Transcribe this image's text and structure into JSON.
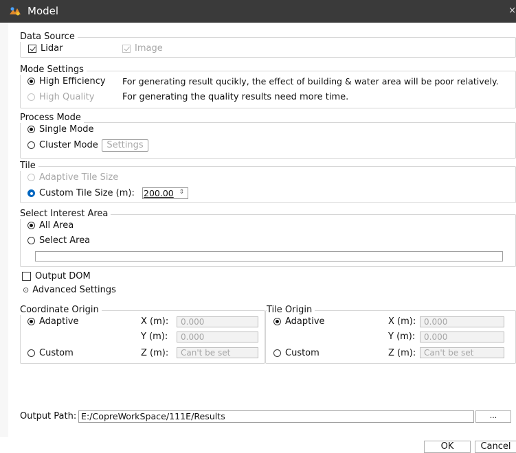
{
  "window": {
    "title": "Model",
    "close_glyph": "×",
    "icon": "app-icon"
  },
  "data_source": {
    "title": "Data Source",
    "lidar": "Lidar",
    "image": "Image"
  },
  "mode_settings": {
    "title": "Mode Settings",
    "high_efficiency": "High Efficiency",
    "high_efficiency_desc": "For generating result qucikly, the effect of building & water area will be poor relatively.",
    "high_quality": "High Quality",
    "high_quality_desc": "For generating the quality results need more time."
  },
  "process_mode": {
    "title": "Process Mode",
    "single": "Single Mode",
    "cluster": "Cluster Mode",
    "settings": "Settings"
  },
  "tile": {
    "title": "Tile",
    "adaptive": "Adaptive Tile Size",
    "custom": "Custom Tile Size (m):",
    "value": "200.00",
    "spin_glyph": "⇕"
  },
  "interest_area": {
    "title": "Select Interest Area",
    "all": "All Area",
    "select": "Select Area",
    "path_value": ""
  },
  "output_dom": "Output DOM",
  "advanced": {
    "label": "Advanced Settings",
    "glyph": "⊙"
  },
  "coordinate_origin": {
    "title": "Coordinate Origin",
    "adaptive": "Adaptive",
    "custom": "Custom",
    "x_label": "X (m):",
    "y_label": "Y (m):",
    "z_label": "Z (m):",
    "x_value": "0.000",
    "y_value": "0.000",
    "z_value": "Can't be set"
  },
  "tile_origin": {
    "title": "Tile Origin",
    "adaptive": "Adaptive",
    "custom": "Custom",
    "x_label": "X (m):",
    "y_label": "Y (m):",
    "z_label": "Z (m):",
    "x_value": "0.000",
    "y_value": "0.000",
    "z_value": "Can't be set"
  },
  "output": {
    "label": "Output Path:",
    "value": "E:/CopreWorkSpace/111E/Results",
    "browse": "..."
  },
  "buttons": {
    "ok": "OK",
    "cancel": "Cancel"
  }
}
